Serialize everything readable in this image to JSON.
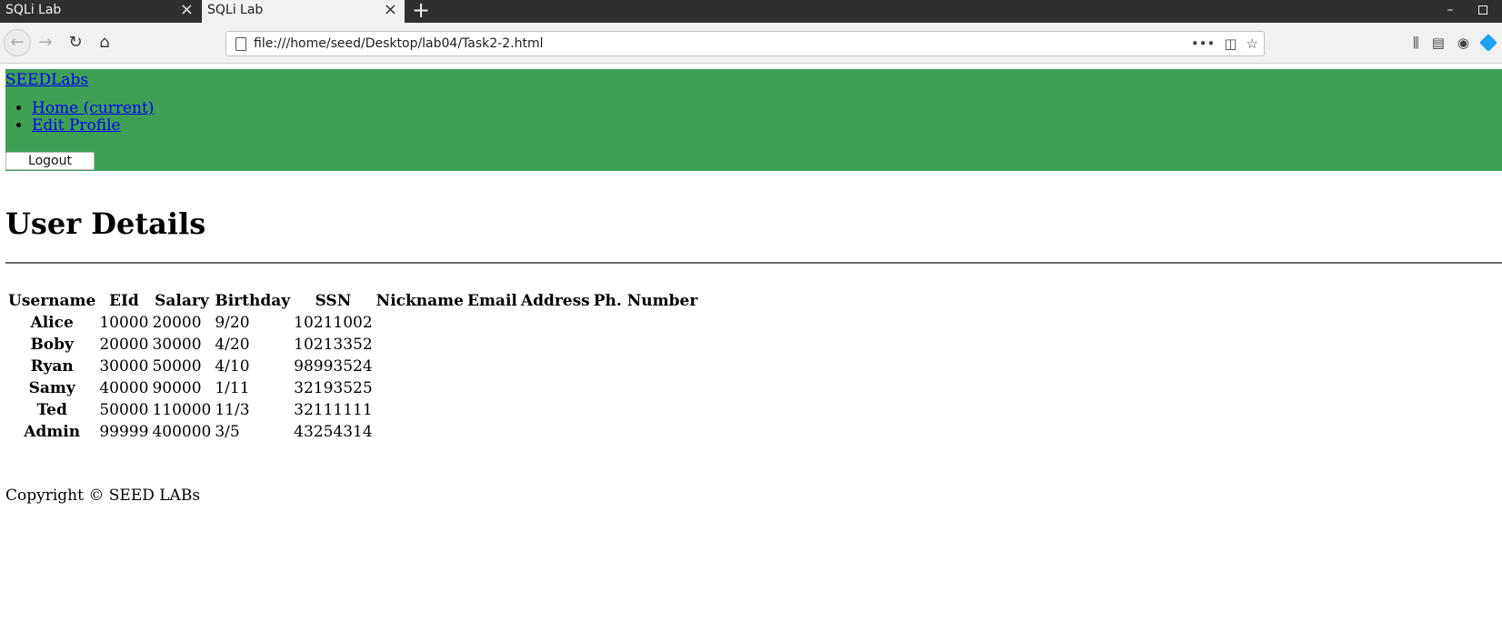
{
  "browser": {
    "tabs": [
      {
        "label": "SQLi Lab",
        "active": false
      },
      {
        "label": "SQLi Lab",
        "active": true
      }
    ],
    "close_glyph": "×",
    "new_tab_glyph": "+",
    "url": "file:///home/seed/Desktop/lab04/Task2-2.html",
    "url_actions": [
      "•••"
    ]
  },
  "icons": {
    "back": "back-arrow-icon",
    "forward": "forward-arrow-icon",
    "reload": "reload-icon",
    "home": "home-icon",
    "page": "page-icon",
    "more": "more-actions-icon",
    "pocket": "pocket-icon",
    "bookmark": "bookmark-star-icon",
    "library": "library-icon",
    "sidebar": "sidebar-icon",
    "account": "account-icon",
    "extension": "extension-icon"
  },
  "colors": {
    "nav_background": "#3fa055",
    "link": "#0000ee"
  },
  "nav": {
    "brand": "SEEDLabs",
    "items": [
      {
        "label": "Home (current)"
      },
      {
        "label": "Edit Profile"
      }
    ],
    "logout_label": "Logout"
  },
  "main": {
    "title": "User Details",
    "table": {
      "headers": [
        "Username",
        "EId",
        "Salary",
        "Birthday",
        "SSN",
        "Nickname",
        "Email",
        "Address",
        "Ph. Number"
      ],
      "rows": [
        [
          "Alice",
          "10000",
          "20000",
          "9/20",
          "10211002",
          "",
          "",
          "",
          ""
        ],
        [
          "Boby",
          "20000",
          "30000",
          "4/20",
          "10213352",
          "",
          "",
          "",
          ""
        ],
        [
          "Ryan",
          "30000",
          "50000",
          "4/10",
          "98993524",
          "",
          "",
          "",
          ""
        ],
        [
          "Samy",
          "40000",
          "90000",
          "1/11",
          "32193525",
          "",
          "",
          "",
          ""
        ],
        [
          "Ted",
          "50000",
          "110000",
          "11/3",
          "32111111",
          "",
          "",
          "",
          ""
        ],
        [
          "Admin",
          "99999",
          "400000",
          "3/5",
          "43254314",
          "",
          "",
          "",
          ""
        ]
      ]
    }
  },
  "footer": {
    "text": "Copyright © SEED LABs"
  }
}
